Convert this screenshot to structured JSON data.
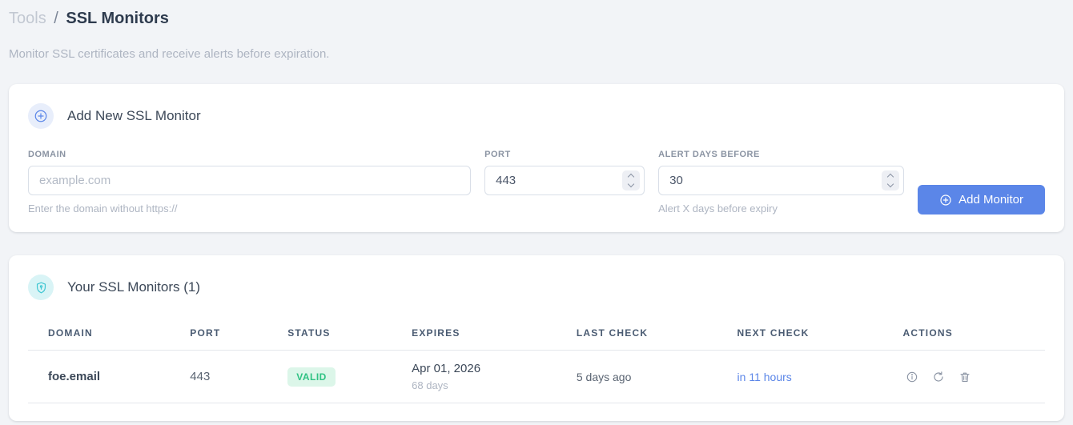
{
  "breadcrumb": {
    "section": "Tools",
    "separator": "/",
    "current": "SSL Monitors"
  },
  "subtitle": "Monitor SSL certificates and receive alerts before expiration.",
  "add_monitor": {
    "title": "Add New SSL Monitor",
    "fields": {
      "domain": {
        "label": "DOMAIN",
        "placeholder": "example.com",
        "help": "Enter the domain without https://"
      },
      "port": {
        "label": "PORT",
        "value": "443"
      },
      "alert_days": {
        "label": "ALERT DAYS BEFORE",
        "value": "30",
        "help": "Alert X days before expiry"
      }
    },
    "submit_label": "Add Monitor"
  },
  "monitors": {
    "title": "Your SSL Monitors (1)",
    "columns": [
      "DOMAIN",
      "PORT",
      "STATUS",
      "EXPIRES",
      "LAST CHECK",
      "NEXT CHECK",
      "ACTIONS"
    ],
    "rows": [
      {
        "domain": "foe.email",
        "port": "443",
        "status": "VALID",
        "expires_date": "Apr 01, 2026",
        "expires_days": "68 days",
        "last_check": "5 days ago",
        "next_check": "in 11 hours"
      }
    ]
  },
  "icons": {
    "header_add": "plus-circle-icon",
    "header_shield": "shield-icon",
    "row_actions": [
      "info-icon",
      "refresh-icon",
      "trash-icon"
    ]
  },
  "colors": {
    "accent_blue": "#5b86e8",
    "valid_badge_bg": "#dcf6e9",
    "valid_badge_text": "#2fc283",
    "shield_teal": "#3ec6d2",
    "page_bg": "#f2f4f7"
  }
}
